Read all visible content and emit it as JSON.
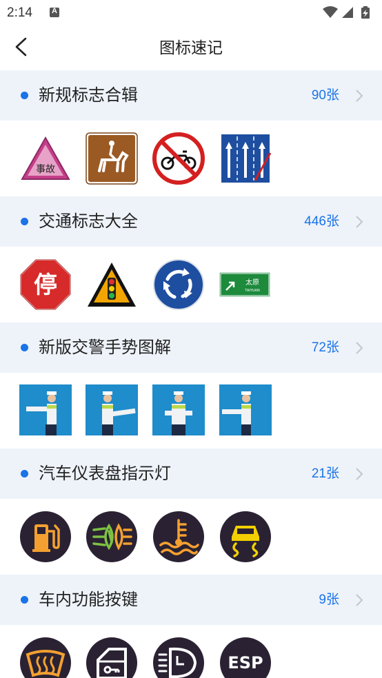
{
  "status_bar": {
    "time": "2:14",
    "notification_icon": "a-icon",
    "wifi_icon": "wifi-icon",
    "cell_icon": "signal-icon",
    "battery_icon": "battery-charging-icon"
  },
  "header": {
    "title": "图标速记",
    "back_icon": "chevron-left-icon"
  },
  "colors": {
    "accent": "#1a73e8",
    "section_bg": "#eef3fa"
  },
  "sections": [
    {
      "title": "新规标志合辑",
      "count": "90张",
      "thumbs": [
        {
          "icon": "accident-warning-sign",
          "label": "事故"
        },
        {
          "icon": "horse-riding-sign"
        },
        {
          "icon": "no-motorcycle-sign"
        },
        {
          "icon": "lane-closed-sign"
        }
      ]
    },
    {
      "title": "交通标志大全",
      "count": "446张",
      "thumbs": [
        {
          "icon": "stop-sign",
          "label": "停"
        },
        {
          "icon": "traffic-light-warning-sign"
        },
        {
          "icon": "roundabout-sign"
        },
        {
          "icon": "direction-sign",
          "label": "太原",
          "sublabel": "TAIYUAN"
        }
      ]
    },
    {
      "title": "新版交警手势图解",
      "count": "72张",
      "thumbs": [
        {
          "icon": "police-gesture-photo"
        },
        {
          "icon": "police-gesture-photo"
        },
        {
          "icon": "police-gesture-photo"
        },
        {
          "icon": "police-gesture-photo"
        }
      ]
    },
    {
      "title": "汽车仪表盘指示灯",
      "count": "21张",
      "thumbs": [
        {
          "icon": "fuel-indicator-icon"
        },
        {
          "icon": "fog-light-indicator-icon"
        },
        {
          "icon": "coolant-temperature-icon"
        },
        {
          "icon": "traction-control-icon"
        }
      ]
    },
    {
      "title": "车内功能按键",
      "count": "9张",
      "thumbs": [
        {
          "icon": "windshield-defrost-icon"
        },
        {
          "icon": "door-lock-icon"
        },
        {
          "icon": "washer-fluid-icon"
        },
        {
          "icon": "esp-button-icon",
          "label": "ESP"
        }
      ]
    }
  ]
}
